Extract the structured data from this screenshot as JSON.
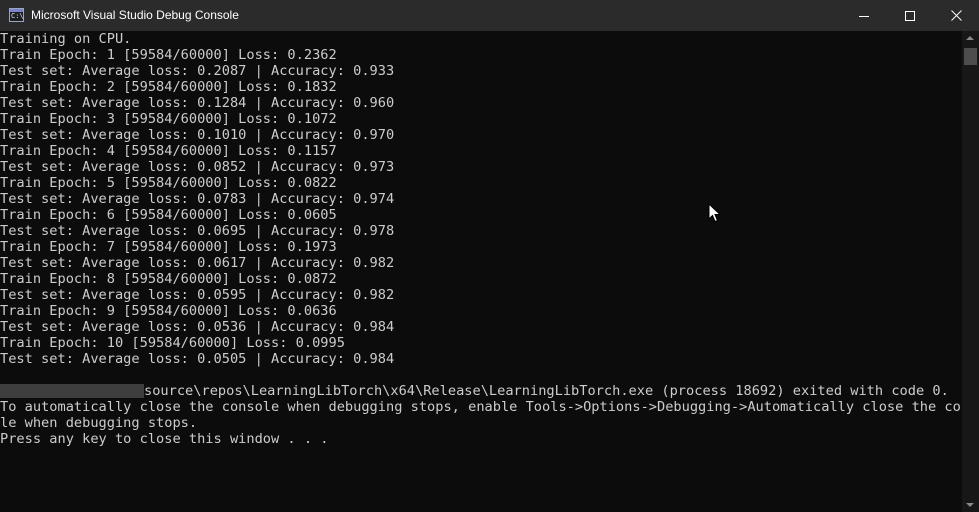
{
  "window": {
    "title": "Microsoft Visual Studio Debug Console",
    "icon": "console-app-icon",
    "icon_glyph": "C:\\",
    "controls": [
      "minimize-icon",
      "maximize-icon",
      "close-icon"
    ]
  },
  "console": {
    "lines": [
      "Training on CPU.",
      "Train Epoch: 1 [59584/60000] Loss: 0.2362",
      "Test set: Average loss: 0.2087 | Accuracy: 0.933",
      "Train Epoch: 2 [59584/60000] Loss: 0.1832",
      "Test set: Average loss: 0.1284 | Accuracy: 0.960",
      "Train Epoch: 3 [59584/60000] Loss: 0.1072",
      "Test set: Average loss: 0.1010 | Accuracy: 0.970",
      "Train Epoch: 4 [59584/60000] Loss: 0.1157",
      "Test set: Average loss: 0.0852 | Accuracy: 0.973",
      "Train Epoch: 5 [59584/60000] Loss: 0.0822",
      "Test set: Average loss: 0.0783 | Accuracy: 0.974",
      "Train Epoch: 6 [59584/60000] Loss: 0.0605",
      "Test set: Average loss: 0.0695 | Accuracy: 0.978",
      "Train Epoch: 7 [59584/60000] Loss: 0.1973",
      "Test set: Average loss: 0.0617 | Accuracy: 0.982",
      "Train Epoch: 8 [59584/60000] Loss: 0.0872",
      "Test set: Average loss: 0.0595 | Accuracy: 0.982",
      "Train Epoch: 9 [59584/60000] Loss: 0.0636",
      "Test set: Average loss: 0.0536 | Accuracy: 0.984",
      "Train Epoch: 10 [59584/60000] Loss: 0.0995",
      "Test set: Average loss: 0.0505 | Accuracy: 0.984"
    ],
    "exit_line": "source\\repos\\LearningLibTorch\\x64\\Release\\LearningLibTorch.exe (process 18692) exited with code 0.",
    "hint_line_1": "To automatically close the console when debugging stops, enable Tools->Options->Debugging->Automatically close the conso",
    "hint_line_2": "le when debugging stops.",
    "press_key_line": "Press any key to close this window . . ."
  },
  "colors": {
    "console_bg": "#0c0c0c",
    "console_text": "#cccccc",
    "titlebar_bg": "#2b2b2b",
    "title_text": "#ffffff"
  }
}
